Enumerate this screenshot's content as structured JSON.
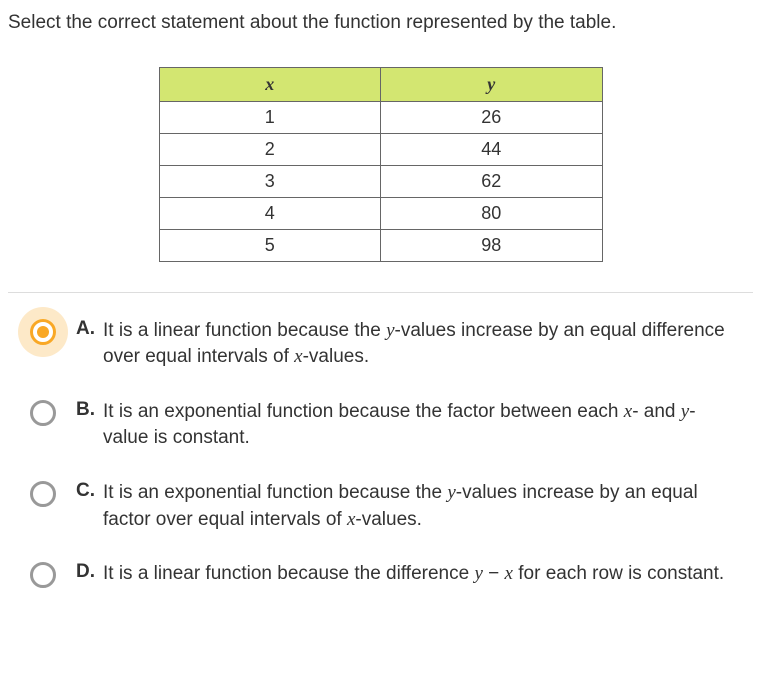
{
  "question": "Select the correct statement about the function represented by the table.",
  "chart_data": {
    "type": "table",
    "columns": [
      "x",
      "y"
    ],
    "rows": [
      {
        "x": "1",
        "y": "26"
      },
      {
        "x": "2",
        "y": "44"
      },
      {
        "x": "3",
        "y": "62"
      },
      {
        "x": "4",
        "y": "80"
      },
      {
        "x": "5",
        "y": "98"
      }
    ]
  },
  "options": [
    {
      "letter": "A.",
      "text_parts": [
        "It is a linear function because the ",
        "y",
        "-values increase by an equal difference over equal intervals of ",
        "x",
        "-values."
      ],
      "selected": true
    },
    {
      "letter": "B.",
      "text_parts": [
        "It is an exponential function because the factor between each ",
        "x",
        "- and ",
        "y",
        "-value is constant."
      ],
      "selected": false
    },
    {
      "letter": "C.",
      "text_parts": [
        "It is an exponential function because the ",
        "y",
        "-values increase by an equal factor over equal intervals of ",
        "x",
        "-values."
      ],
      "selected": false
    },
    {
      "letter": "D.",
      "text_parts": [
        "It is a linear function because the difference ",
        "y",
        " − ",
        "x",
        " for each row is constant."
      ],
      "selected": false
    }
  ]
}
